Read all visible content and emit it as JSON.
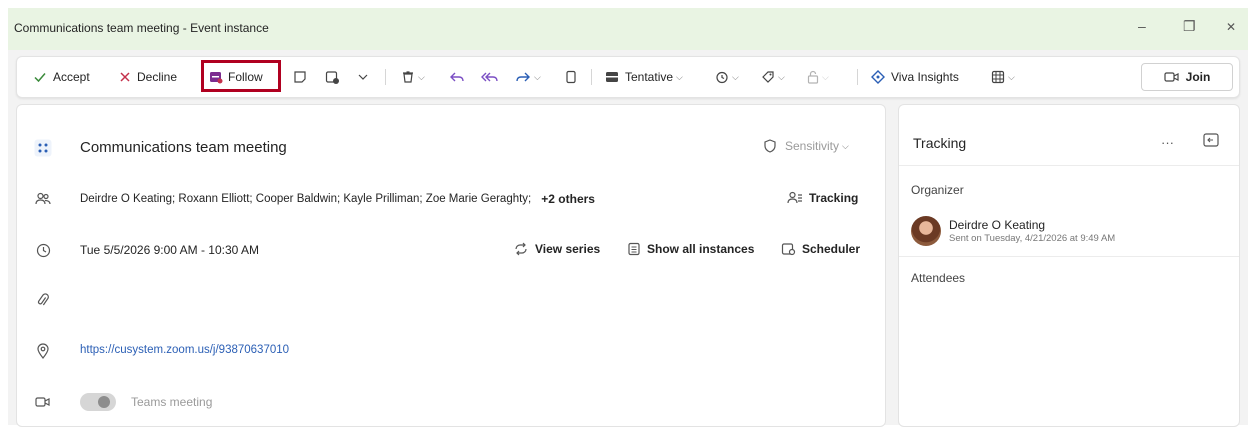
{
  "window": {
    "title": "Communications team meeting - Event instance",
    "minimize": "–",
    "restore": "❐",
    "close": "✕"
  },
  "toolbar": {
    "accept_label": "Accept",
    "decline_label": "Decline",
    "follow_label": "Follow",
    "tentative_label": "Tentative",
    "viva_label": "Viva Insights",
    "join_label": "Join"
  },
  "event": {
    "subject": "Communications team meeting",
    "sensitivity_label": "Sensitivity",
    "attendees": "Deirdre O Keating;  Roxann Elliott;  Cooper Baldwin;  Kayle Prilliman;  Zoe Marie Geraghty;",
    "others": "+2 others",
    "tracking_label": "Tracking",
    "datetime": "Tue 5/5/2026 9:00 AM - 10:30 AM",
    "view_series": "View series",
    "show_all_instances": "Show all instances",
    "scheduler": "Scheduler",
    "location_url": "https://cusystem.zoom.us/j/93870637010",
    "teams_label": "Teams meeting"
  },
  "tracking_panel": {
    "title": "Tracking",
    "more": "···",
    "organizer_heading": "Organizer",
    "organizer_name": "Deirdre O Keating",
    "organizer_sent": "Sent on Tuesday, 4/21/2026 at 9:49 AM",
    "attendees_heading": "Attendees"
  },
  "colors": {
    "titlebar_bg": "#e9f4e3",
    "accept_green": "#3a8a3a",
    "decline_red": "#c4314b",
    "follow_purple": "#7b2c8f",
    "reply_purple": "#7b4fc4",
    "highlight_box": "#b00020",
    "link_blue": "#2b5fb5"
  }
}
